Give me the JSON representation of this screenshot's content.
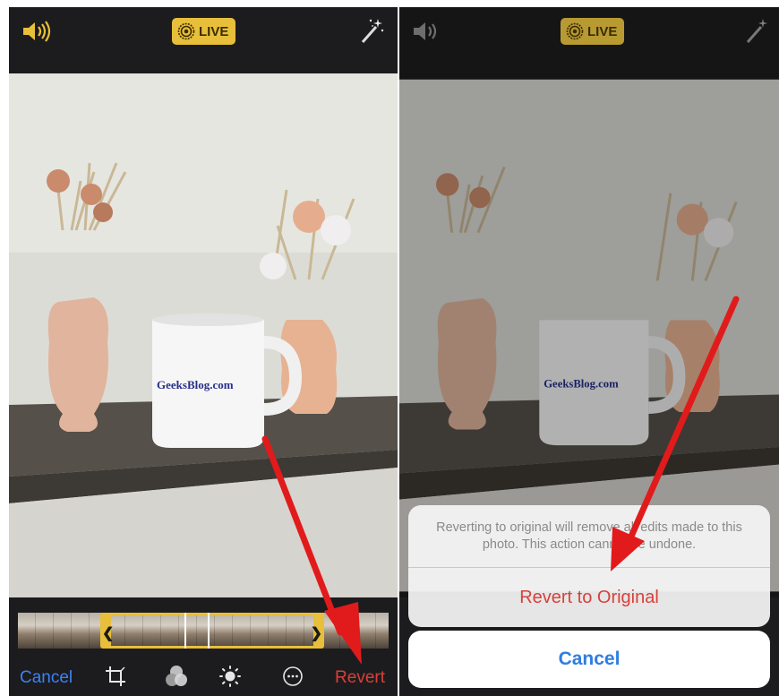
{
  "left": {
    "live_label": "LIVE",
    "toolbar": {
      "cancel_label": "Cancel",
      "revert_label": "Revert"
    },
    "icons": [
      "speaker-icon",
      "live-icon",
      "magic-wand-icon",
      "crop-icon",
      "filters-icon",
      "adjust-icon",
      "more-icon"
    ]
  },
  "right": {
    "live_label": "LIVE",
    "alert": {
      "message": "Reverting to original will remove all edits made to this photo. This action cannot be undone.",
      "action_label": "Revert to Original",
      "cancel_label": "Cancel"
    }
  },
  "photo": {
    "watermark": "GeeksBlog.com"
  },
  "colors": {
    "accent_yellow": "#e8bf3a",
    "ios_blue": "#2f7de1",
    "destructive_red": "#d9403a",
    "annotation_red": "#e11b1b"
  }
}
